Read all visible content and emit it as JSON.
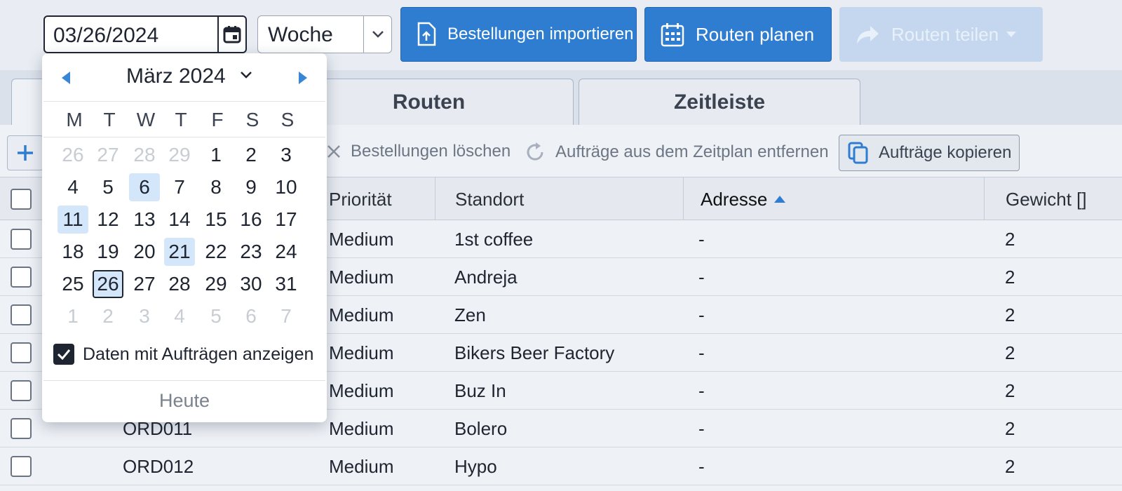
{
  "toolbar": {
    "date_value": "03/26/2024",
    "period_value": "Woche",
    "import_label": "Bestellungen importieren",
    "plan_label": "Routen planen",
    "share_label": "Routen teilen"
  },
  "tabs": {
    "first": "",
    "routes": "Routen",
    "timeline": "Zeitleiste"
  },
  "actions": {
    "delete_label": "Bestellungen löschen",
    "remove_label": "Aufträge aus dem Zeitplan entfernen",
    "copy_label": "Aufträge kopieren"
  },
  "table": {
    "headers": {
      "priority": "Priorität",
      "location": "Standort",
      "address": "Adresse",
      "weight": "Gewicht []"
    },
    "rows": [
      {
        "order": "",
        "priority": "Medium",
        "location": "1st coffee",
        "address": "-",
        "weight": "2"
      },
      {
        "order": "",
        "priority": "Medium",
        "location": "Andreja",
        "address": "-",
        "weight": "2"
      },
      {
        "order": "",
        "priority": "Medium",
        "location": "Zen",
        "address": "-",
        "weight": "2"
      },
      {
        "order": "",
        "priority": "Medium",
        "location": "Bikers Beer Factory",
        "address": "-",
        "weight": "2"
      },
      {
        "order": "",
        "priority": "Medium",
        "location": "Buz In",
        "address": "-",
        "weight": "2"
      },
      {
        "order": "ORD011",
        "priority": "Medium",
        "location": "Bolero",
        "address": "-",
        "weight": "2"
      },
      {
        "order": "ORD012",
        "priority": "Medium",
        "location": "Hypo",
        "address": "-",
        "weight": "2"
      }
    ]
  },
  "calendar": {
    "month_label": "März 2024",
    "weekdays": [
      "M",
      "T",
      "W",
      "T",
      "F",
      "S",
      "S"
    ],
    "weeks": [
      [
        "26",
        "27",
        "28",
        "29",
        "1",
        "2",
        "3"
      ],
      [
        "4",
        "5",
        "6",
        "7",
        "8",
        "9",
        "10"
      ],
      [
        "11",
        "12",
        "13",
        "14",
        "15",
        "16",
        "17"
      ],
      [
        "18",
        "19",
        "20",
        "21",
        "22",
        "23",
        "24"
      ],
      [
        "25",
        "26",
        "27",
        "28",
        "29",
        "30",
        "31"
      ],
      [
        "1",
        "2",
        "3",
        "4",
        "5",
        "6",
        "7"
      ]
    ],
    "outside_month_days": [
      "w0d0",
      "w0d1",
      "w0d2",
      "w0d3",
      "w5d0",
      "w5d1",
      "w5d2",
      "w5d3",
      "w5d4",
      "w5d5",
      "w5d6"
    ],
    "marked_days": [
      "w1d2",
      "w2d0",
      "w3d3"
    ],
    "selected_day": "w4d1",
    "show_dates_label": "Daten mit Aufträgen anzeigen",
    "show_dates_checked": true,
    "today_label": "Heute"
  },
  "colors": {
    "primary": "#2f7dd1",
    "primary_disabled": "#c5d7ef",
    "highlight": "#d3e6fa",
    "background": "#eef1f6"
  }
}
